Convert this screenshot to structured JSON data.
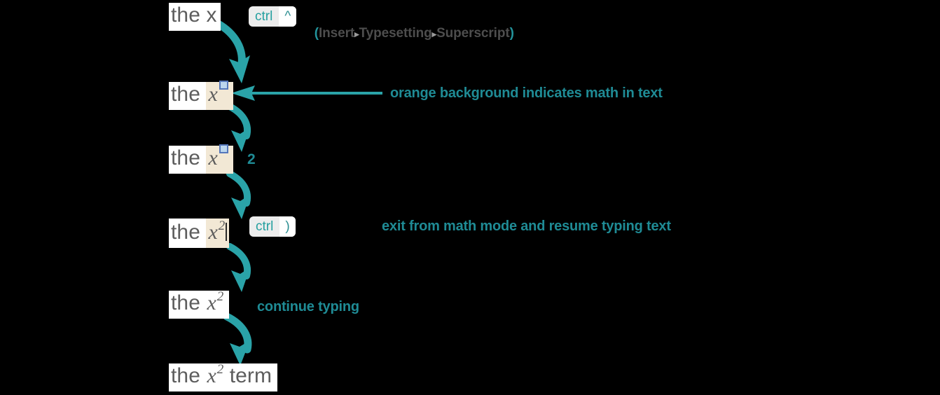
{
  "colors": {
    "background": "#000000",
    "teal": "#2aa3a8",
    "teal_text": "#1f8b95",
    "math_background": "#f2e8d5",
    "text_gray": "#5d5d5d",
    "menu_gray": "#4d4d4d",
    "placeholder_blue": "#5577bb",
    "placeholder_fill": "#bcd6ee",
    "keycap_gray": "#ececec",
    "block_white": "#ffffff"
  },
  "steps": [
    {
      "id": "step-1",
      "prefix": "the x",
      "math_text": "",
      "superscript": "",
      "has_placeholder": false,
      "has_caret": false,
      "suffix": ""
    },
    {
      "id": "step-2",
      "prefix": "the ",
      "math_text": "x",
      "superscript": "",
      "has_placeholder": true,
      "has_caret": false,
      "suffix": ""
    },
    {
      "id": "step-3",
      "prefix": "the ",
      "math_text": "x",
      "superscript": "",
      "has_placeholder": true,
      "has_caret": false,
      "suffix": ""
    },
    {
      "id": "step-4",
      "prefix": "the ",
      "math_text": "x",
      "superscript": "2",
      "has_placeholder": false,
      "has_caret": true,
      "suffix": ""
    },
    {
      "id": "step-5",
      "prefix": "the ",
      "math_text": "x",
      "superscript": "2",
      "has_placeholder": false,
      "has_caret": false,
      "suffix": ""
    },
    {
      "id": "step-6",
      "prefix": "the ",
      "math_text": "x",
      "superscript": "2",
      "has_placeholder": false,
      "has_caret": false,
      "suffix": " term"
    }
  ],
  "keycaps": {
    "superscript": {
      "modifier": "ctrl",
      "key": "^"
    },
    "exit_math": {
      "modifier": "ctrl",
      "key": ")"
    }
  },
  "menu_path": {
    "open_paren": "(",
    "items": [
      "Insert",
      "Typesetting",
      "Superscript"
    ],
    "separator": "▸",
    "close_paren": ")"
  },
  "annotations": {
    "orange_background": "orange background indicates math in text",
    "exit_math_mode": "exit from math mode and resume typing text",
    "continue_typing": "continue typing",
    "typed_two": "2"
  }
}
